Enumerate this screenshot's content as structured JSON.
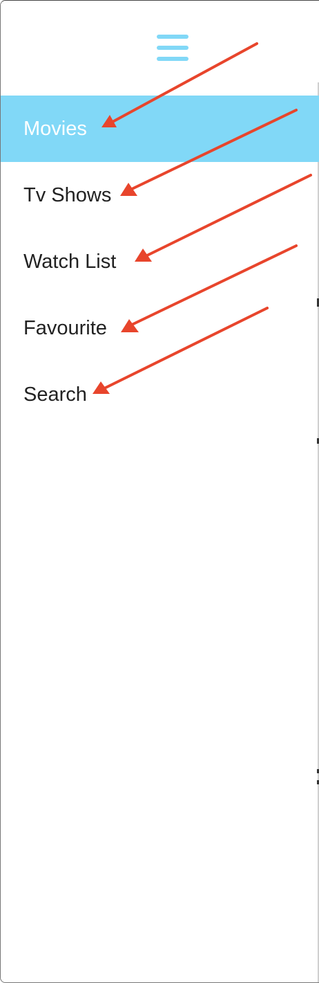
{
  "menu": {
    "icon": "hamburger-icon",
    "items": [
      {
        "label": "Movies",
        "active": true
      },
      {
        "label": "Tv Shows",
        "active": false
      },
      {
        "label": "Watch List",
        "active": false
      },
      {
        "label": "Favourite",
        "active": false
      },
      {
        "label": "Search",
        "active": false
      }
    ]
  },
  "colors": {
    "accent": "#81d8f7",
    "arrow": "#e8452c",
    "text": "#222222",
    "active_text": "#ffffff"
  }
}
